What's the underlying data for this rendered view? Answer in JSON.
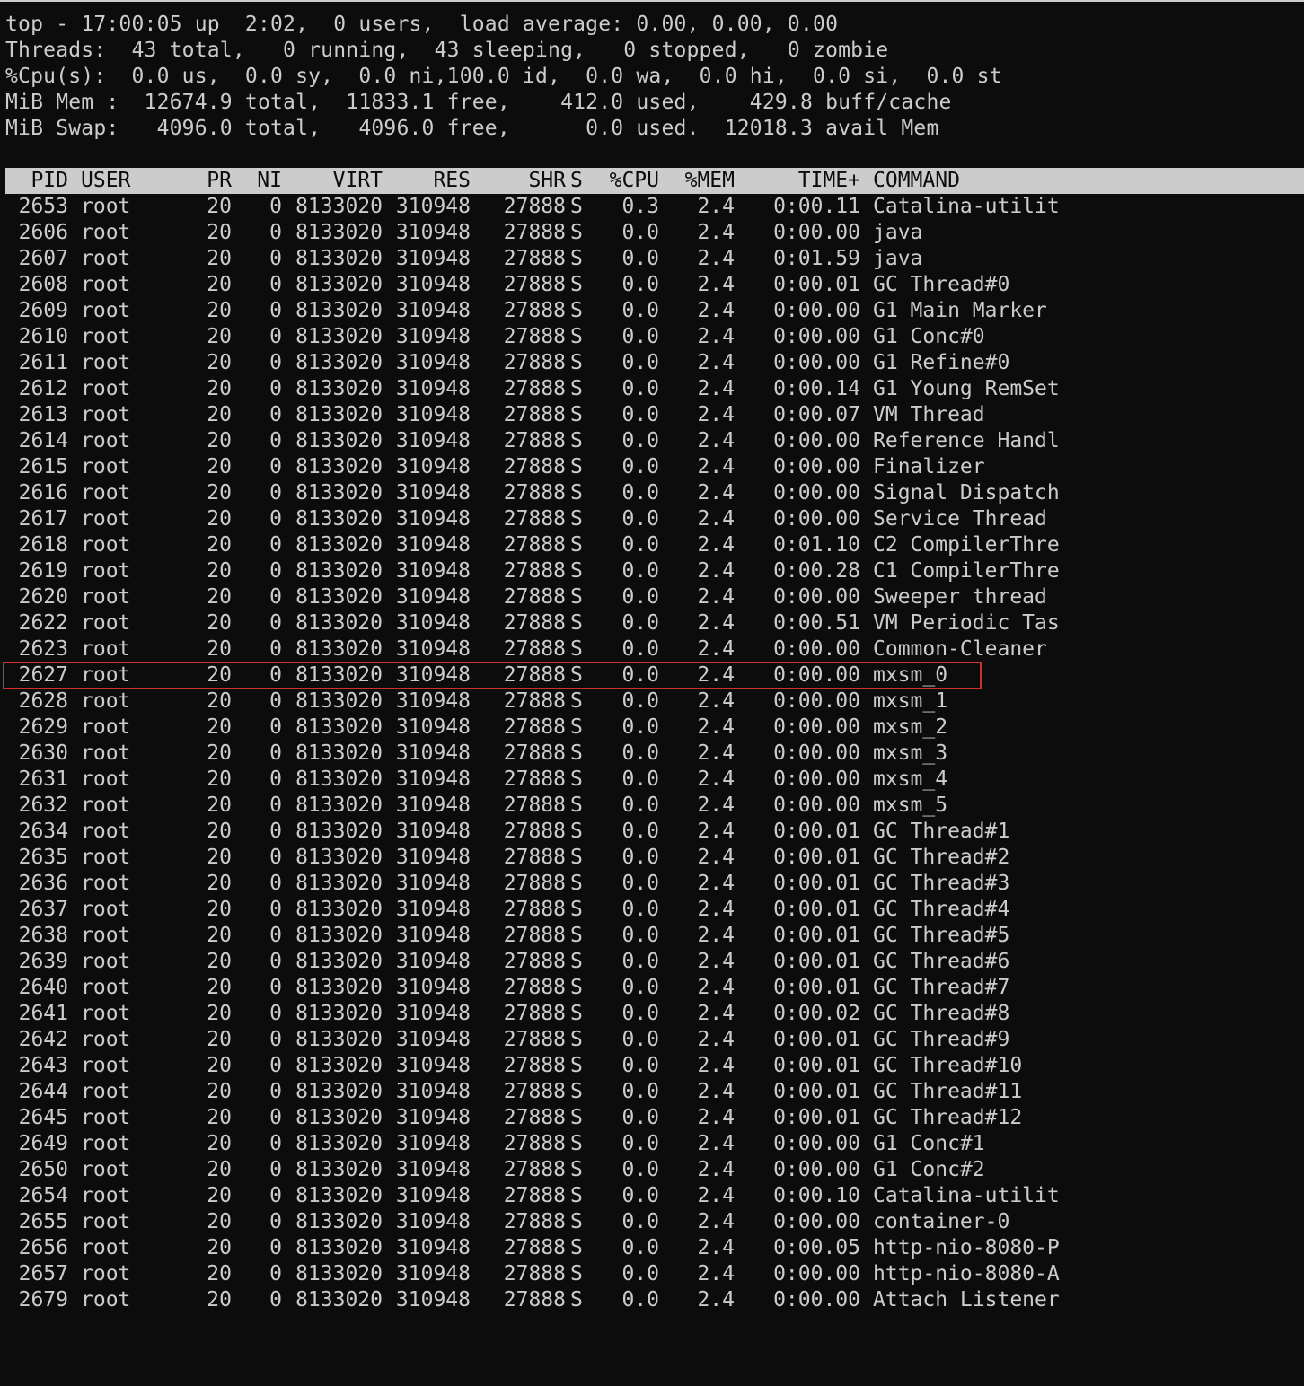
{
  "summary": [
    "top - 17:00:05 up  2:02,  0 users,  load average: 0.00, 0.00, 0.00",
    "Threads:  43 total,   0 running,  43 sleeping,   0 stopped,   0 zombie",
    "%Cpu(s):  0.0 us,  0.0 sy,  0.0 ni,100.0 id,  0.0 wa,  0.0 hi,  0.0 si,  0.0 st",
    "MiB Mem :  12674.9 total,  11833.1 free,    412.0 used,    429.8 buff/cache",
    "MiB Swap:   4096.0 total,   4096.0 free,      0.0 used.  12018.3 avail Mem"
  ],
  "columns": [
    "PID",
    "USER",
    "PR",
    "NI",
    "VIRT",
    "RES",
    "SHR",
    "S",
    "%CPU",
    "%MEM",
    "TIME+",
    "COMMAND"
  ],
  "rows": [
    [
      "2653",
      "root",
      "20",
      "0",
      "8133020",
      "310948",
      "27888",
      "S",
      "0.3",
      "2.4",
      "0:00.11",
      "Catalina-utilit"
    ],
    [
      "2606",
      "root",
      "20",
      "0",
      "8133020",
      "310948",
      "27888",
      "S",
      "0.0",
      "2.4",
      "0:00.00",
      "java"
    ],
    [
      "2607",
      "root",
      "20",
      "0",
      "8133020",
      "310948",
      "27888",
      "S",
      "0.0",
      "2.4",
      "0:01.59",
      "java"
    ],
    [
      "2608",
      "root",
      "20",
      "0",
      "8133020",
      "310948",
      "27888",
      "S",
      "0.0",
      "2.4",
      "0:00.01",
      "GC Thread#0"
    ],
    [
      "2609",
      "root",
      "20",
      "0",
      "8133020",
      "310948",
      "27888",
      "S",
      "0.0",
      "2.4",
      "0:00.00",
      "G1 Main Marker"
    ],
    [
      "2610",
      "root",
      "20",
      "0",
      "8133020",
      "310948",
      "27888",
      "S",
      "0.0",
      "2.4",
      "0:00.00",
      "G1 Conc#0"
    ],
    [
      "2611",
      "root",
      "20",
      "0",
      "8133020",
      "310948",
      "27888",
      "S",
      "0.0",
      "2.4",
      "0:00.00",
      "G1 Refine#0"
    ],
    [
      "2612",
      "root",
      "20",
      "0",
      "8133020",
      "310948",
      "27888",
      "S",
      "0.0",
      "2.4",
      "0:00.14",
      "G1 Young RemSet"
    ],
    [
      "2613",
      "root",
      "20",
      "0",
      "8133020",
      "310948",
      "27888",
      "S",
      "0.0",
      "2.4",
      "0:00.07",
      "VM Thread"
    ],
    [
      "2614",
      "root",
      "20",
      "0",
      "8133020",
      "310948",
      "27888",
      "S",
      "0.0",
      "2.4",
      "0:00.00",
      "Reference Handl"
    ],
    [
      "2615",
      "root",
      "20",
      "0",
      "8133020",
      "310948",
      "27888",
      "S",
      "0.0",
      "2.4",
      "0:00.00",
      "Finalizer"
    ],
    [
      "2616",
      "root",
      "20",
      "0",
      "8133020",
      "310948",
      "27888",
      "S",
      "0.0",
      "2.4",
      "0:00.00",
      "Signal Dispatch"
    ],
    [
      "2617",
      "root",
      "20",
      "0",
      "8133020",
      "310948",
      "27888",
      "S",
      "0.0",
      "2.4",
      "0:00.00",
      "Service Thread"
    ],
    [
      "2618",
      "root",
      "20",
      "0",
      "8133020",
      "310948",
      "27888",
      "S",
      "0.0",
      "2.4",
      "0:01.10",
      "C2 CompilerThre"
    ],
    [
      "2619",
      "root",
      "20",
      "0",
      "8133020",
      "310948",
      "27888",
      "S",
      "0.0",
      "2.4",
      "0:00.28",
      "C1 CompilerThre"
    ],
    [
      "2620",
      "root",
      "20",
      "0",
      "8133020",
      "310948",
      "27888",
      "S",
      "0.0",
      "2.4",
      "0:00.00",
      "Sweeper thread"
    ],
    [
      "2622",
      "root",
      "20",
      "0",
      "8133020",
      "310948",
      "27888",
      "S",
      "0.0",
      "2.4",
      "0:00.51",
      "VM Periodic Tas"
    ],
    [
      "2623",
      "root",
      "20",
      "0",
      "8133020",
      "310948",
      "27888",
      "S",
      "0.0",
      "2.4",
      "0:00.00",
      "Common-Cleaner"
    ],
    [
      "2627",
      "root",
      "20",
      "0",
      "8133020",
      "310948",
      "27888",
      "S",
      "0.0",
      "2.4",
      "0:00.00",
      "mxsm_0"
    ],
    [
      "2628",
      "root",
      "20",
      "0",
      "8133020",
      "310948",
      "27888",
      "S",
      "0.0",
      "2.4",
      "0:00.00",
      "mxsm_1"
    ],
    [
      "2629",
      "root",
      "20",
      "0",
      "8133020",
      "310948",
      "27888",
      "S",
      "0.0",
      "2.4",
      "0:00.00",
      "mxsm_2"
    ],
    [
      "2630",
      "root",
      "20",
      "0",
      "8133020",
      "310948",
      "27888",
      "S",
      "0.0",
      "2.4",
      "0:00.00",
      "mxsm_3"
    ],
    [
      "2631",
      "root",
      "20",
      "0",
      "8133020",
      "310948",
      "27888",
      "S",
      "0.0",
      "2.4",
      "0:00.00",
      "mxsm_4"
    ],
    [
      "2632",
      "root",
      "20",
      "0",
      "8133020",
      "310948",
      "27888",
      "S",
      "0.0",
      "2.4",
      "0:00.00",
      "mxsm_5"
    ],
    [
      "2634",
      "root",
      "20",
      "0",
      "8133020",
      "310948",
      "27888",
      "S",
      "0.0",
      "2.4",
      "0:00.01",
      "GC Thread#1"
    ],
    [
      "2635",
      "root",
      "20",
      "0",
      "8133020",
      "310948",
      "27888",
      "S",
      "0.0",
      "2.4",
      "0:00.01",
      "GC Thread#2"
    ],
    [
      "2636",
      "root",
      "20",
      "0",
      "8133020",
      "310948",
      "27888",
      "S",
      "0.0",
      "2.4",
      "0:00.01",
      "GC Thread#3"
    ],
    [
      "2637",
      "root",
      "20",
      "0",
      "8133020",
      "310948",
      "27888",
      "S",
      "0.0",
      "2.4",
      "0:00.01",
      "GC Thread#4"
    ],
    [
      "2638",
      "root",
      "20",
      "0",
      "8133020",
      "310948",
      "27888",
      "S",
      "0.0",
      "2.4",
      "0:00.01",
      "GC Thread#5"
    ],
    [
      "2639",
      "root",
      "20",
      "0",
      "8133020",
      "310948",
      "27888",
      "S",
      "0.0",
      "2.4",
      "0:00.01",
      "GC Thread#6"
    ],
    [
      "2640",
      "root",
      "20",
      "0",
      "8133020",
      "310948",
      "27888",
      "S",
      "0.0",
      "2.4",
      "0:00.01",
      "GC Thread#7"
    ],
    [
      "2641",
      "root",
      "20",
      "0",
      "8133020",
      "310948",
      "27888",
      "S",
      "0.0",
      "2.4",
      "0:00.02",
      "GC Thread#8"
    ],
    [
      "2642",
      "root",
      "20",
      "0",
      "8133020",
      "310948",
      "27888",
      "S",
      "0.0",
      "2.4",
      "0:00.01",
      "GC Thread#9"
    ],
    [
      "2643",
      "root",
      "20",
      "0",
      "8133020",
      "310948",
      "27888",
      "S",
      "0.0",
      "2.4",
      "0:00.01",
      "GC Thread#10"
    ],
    [
      "2644",
      "root",
      "20",
      "0",
      "8133020",
      "310948",
      "27888",
      "S",
      "0.0",
      "2.4",
      "0:00.01",
      "GC Thread#11"
    ],
    [
      "2645",
      "root",
      "20",
      "0",
      "8133020",
      "310948",
      "27888",
      "S",
      "0.0",
      "2.4",
      "0:00.01",
      "GC Thread#12"
    ],
    [
      "2649",
      "root",
      "20",
      "0",
      "8133020",
      "310948",
      "27888",
      "S",
      "0.0",
      "2.4",
      "0:00.00",
      "G1 Conc#1"
    ],
    [
      "2650",
      "root",
      "20",
      "0",
      "8133020",
      "310948",
      "27888",
      "S",
      "0.0",
      "2.4",
      "0:00.00",
      "G1 Conc#2"
    ],
    [
      "2654",
      "root",
      "20",
      "0",
      "8133020",
      "310948",
      "27888",
      "S",
      "0.0",
      "2.4",
      "0:00.10",
      "Catalina-utilit"
    ],
    [
      "2655",
      "root",
      "20",
      "0",
      "8133020",
      "310948",
      "27888",
      "S",
      "0.0",
      "2.4",
      "0:00.00",
      "container-0"
    ],
    [
      "2656",
      "root",
      "20",
      "0",
      "8133020",
      "310948",
      "27888",
      "S",
      "0.0",
      "2.4",
      "0:00.05",
      "http-nio-8080-P"
    ],
    [
      "2657",
      "root",
      "20",
      "0",
      "8133020",
      "310948",
      "27888",
      "S",
      "0.0",
      "2.4",
      "0:00.00",
      "http-nio-8080-A"
    ],
    [
      "2679",
      "root",
      "20",
      "0",
      "8133020",
      "310948",
      "27888",
      "S",
      "0.0",
      "2.4",
      "0:00.00",
      "Attach Listener"
    ]
  ],
  "highlighted_pid": "2627",
  "colors": {
    "background": "#0c0c0c",
    "text": "#cccccc",
    "header_background": "#cccccc",
    "highlight_border": "#d0302a"
  }
}
